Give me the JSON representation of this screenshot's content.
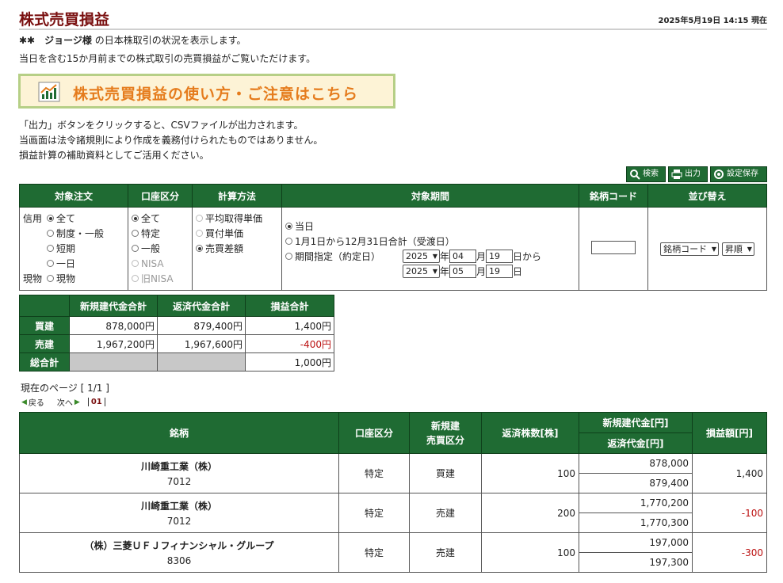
{
  "header": {
    "title": "株式売買損益",
    "timestamp": "2025年5月19日 14:15 現在"
  },
  "intro": {
    "prefix": "✱✱　",
    "user": "ジョージ様",
    "line1_suffix": " の日本株取引の状況を表示します。",
    "line2": "当日を含む15か月前までの株式取引の売買損益がご覧いただけます。"
  },
  "banner": {
    "label": "株式売買損益の使い方・ご注意はこちら"
  },
  "notes": [
    "「出力」ボタンをクリックすると、CSVファイルが出力されます。",
    "当画面は法令諸規則により作成を義務付けられたものではありません。",
    "損益計算の補助資料としてご活用ください。"
  ],
  "toolbar": {
    "search": "検索",
    "output": "出力",
    "save": "設定保存"
  },
  "conditions": {
    "headers": [
      "対象注文",
      "口座区分",
      "計算方法",
      "対象期間",
      "銘柄コード",
      "並び替え"
    ],
    "order": {
      "credit_label": "信用",
      "spot_label": "現物",
      "credit_opts": [
        "全て",
        "制度・一般",
        "短期",
        "一日"
      ],
      "spot_opts": [
        "現物"
      ]
    },
    "account": [
      "全て",
      "特定",
      "一般",
      "NISA",
      "旧NISA"
    ],
    "calc": [
      "平均取得単価",
      "買付単価",
      "売買差額"
    ],
    "period": {
      "today": "当日",
      "year": "1月1日から12月31日合計（受渡日）",
      "range": "期間指定（約定日）",
      "from_year": "2025",
      "from_month": "04",
      "from_day": "19",
      "to_year": "2025",
      "to_month": "05",
      "to_day": "19",
      "year_unit": "年",
      "month_unit": "月",
      "from_suffix": "日から",
      "to_suffix": "日"
    },
    "code_value": "",
    "sort": {
      "key": "銘柄コード",
      "order": "昇順"
    }
  },
  "summary": {
    "headers": [
      "",
      "新規建代金合計",
      "返済代金合計",
      "損益合計"
    ],
    "rows": [
      {
        "label": "買建",
        "open": "878,000円",
        "close": "879,400円",
        "pl": "1,400円"
      },
      {
        "label": "売建",
        "open": "1,967,200円",
        "close": "1,967,600円",
        "pl": "-400円"
      },
      {
        "label": "総合計",
        "pl": "1,000円"
      }
    ]
  },
  "paging": {
    "current": "現在のページ [ 1/1 ]",
    "prev": "戻る",
    "next": "次へ",
    "page": "01"
  },
  "results": {
    "headers": {
      "name": "銘柄",
      "account": "口座区分",
      "side": "新規建\n売買区分",
      "qty": "返済株数[株]",
      "open": "新規建代金[円]",
      "close": "返済代金[円]",
      "pl": "損益額[円]"
    },
    "rows": [
      {
        "name": "川崎重工業（株）",
        "code": "7012",
        "account": "特定",
        "side": "買建",
        "qty": "100",
        "open": "878,000",
        "close": "879,400",
        "pl": "1,400"
      },
      {
        "name": "川崎重工業（株）",
        "code": "7012",
        "account": "特定",
        "side": "売建",
        "qty": "200",
        "open": "1,770,200",
        "close": "1,770,300",
        "pl": "-100"
      },
      {
        "name": "（株）三菱ＵＦＪフィナンシャル・グループ",
        "code": "8306",
        "account": "特定",
        "side": "売建",
        "qty": "100",
        "open": "197,000",
        "close": "197,300",
        "pl": "-300"
      }
    ]
  }
}
